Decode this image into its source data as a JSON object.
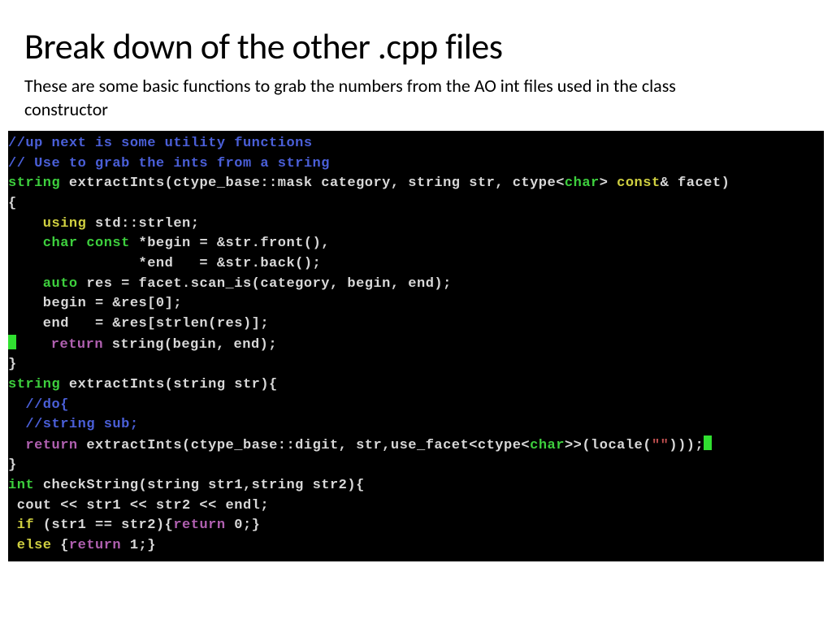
{
  "title": "Break down of the other .cpp files",
  "subtitle": "These are some basic functions to grab the numbers from the AO int files used in the class constructor",
  "code": {
    "l1": "//up next is some utility functions",
    "l2": "// Use to grab the ints from a string",
    "l3a": "string ",
    "l3b": "extractInts(ctype_base::mask category, string str, ctype",
    "l3c": "<",
    "l3d": "char",
    "l3e": "> ",
    "l3f": "const",
    "l3g": "& facet)",
    "l4": "{",
    "l5a": "    using ",
    "l5b": "std::strlen;",
    "l6a": "    char const ",
    "l6b": "*begin = &str.front(),",
    "l7": "               *end   = &str.back();",
    "l8a": "    auto ",
    "l8b": "res = facet.scan_is(category, begin, end);",
    "l9": "    begin = &res[0];",
    "l10": "    end   = &res[strlen(res)];",
    "l11a": "    return ",
    "l11b": "string(begin, end);",
    "l12": "}",
    "l13a": "string ",
    "l13b": "extractInts(string str){",
    "l14": "  //do{",
    "l15": "  //string sub;",
    "l16a": "  return ",
    "l16b": "extractInts(ctype_base::digit, str,use_facet",
    "l16c": "<",
    "l16d": "ctype",
    "l16e": "<",
    "l16f": "char",
    "l16g": ">>",
    "l16h": "(locale(",
    "l16i": "\"\"",
    "l16j": ")));",
    "l17": "}",
    "l18a": "int ",
    "l18b": "checkString(string str1,string str2){",
    "l19": " cout << str1 << str2 << endl;",
    "l20a": " if ",
    "l20b": "(str1 == str2){",
    "l20c": "return ",
    "l20d": "0;}",
    "l21a": " else ",
    "l21b": "{",
    "l21c": "return ",
    "l21d": "1;}"
  }
}
